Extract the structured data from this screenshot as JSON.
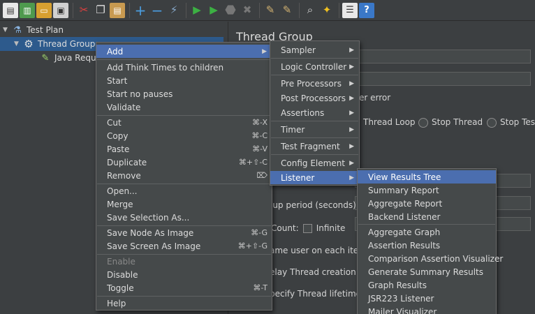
{
  "toolbar": {
    "buttons": [
      {
        "name": "new-icon",
        "glyph": "📄"
      },
      {
        "name": "templates-icon",
        "glyph": "📗"
      },
      {
        "name": "open-icon",
        "glyph": "📂"
      },
      {
        "name": "save-icon",
        "glyph": "💾"
      },
      {
        "name": "cut-icon",
        "glyph": "✂"
      },
      {
        "name": "copy-icon",
        "glyph": "❐"
      },
      {
        "name": "paste-icon",
        "glyph": "📋"
      },
      {
        "name": "expand-icon",
        "glyph": "+"
      },
      {
        "name": "collapse-icon",
        "glyph": "−"
      },
      {
        "name": "toggle-icon",
        "glyph": "⚡"
      },
      {
        "name": "start-icon",
        "glyph": "▶"
      },
      {
        "name": "start-no-pauses-icon",
        "glyph": "▶"
      },
      {
        "name": "stop-icon",
        "glyph": "⬣"
      },
      {
        "name": "shutdown-icon",
        "glyph": "✖"
      },
      {
        "name": "clear-icon",
        "glyph": "🧹"
      },
      {
        "name": "clear-all-icon",
        "glyph": "🧹"
      },
      {
        "name": "search-icon",
        "glyph": "🔭"
      },
      {
        "name": "reset-search-icon",
        "glyph": "🧽"
      },
      {
        "name": "function-helper-icon",
        "glyph": "☰"
      },
      {
        "name": "help-icon",
        "glyph": "?"
      }
    ]
  },
  "tree": {
    "test_plan": "Test Plan",
    "thread_group": "Thread Group",
    "java_request": "Java Requ"
  },
  "right_panel": {
    "title": "Thread Group",
    "error_text": "er error",
    "radio_thread_loop": "Thread Loop",
    "radio_stop_thread": "Stop Thread",
    "radio_stop_test": "Stop Tes",
    "ramp_up": "-up period (seconds):",
    "loop_count": "Count:",
    "infinite": "Infinite",
    "same_user": "ame user on each itera",
    "delay_thread": "elay Thread creation u",
    "specify_lifetime": "pecify Thread lifetime"
  },
  "context_menu": {
    "add": "Add",
    "add_think_times": "Add Think Times to children",
    "start": "Start",
    "start_no_pauses": "Start no pauses",
    "validate": "Validate",
    "cut": "Cut",
    "cut_acc": "⌘-X",
    "copy": "Copy",
    "copy_acc": "⌘-C",
    "paste": "Paste",
    "paste_acc": "⌘-V",
    "duplicate": "Duplicate",
    "duplicate_acc": "⌘+⇧-C",
    "remove": "Remove",
    "remove_acc": "⌦",
    "open": "Open...",
    "merge": "Merge",
    "save_selection_as": "Save Selection As...",
    "save_node_as_image": "Save Node As Image",
    "save_node_acc": "⌘-G",
    "save_screen_as_image": "Save Screen As Image",
    "save_screen_acc": "⌘+⇧-G",
    "enable": "Enable",
    "disable": "Disable",
    "toggle": "Toggle",
    "toggle_acc": "⌘-T",
    "help": "Help"
  },
  "add_menu": {
    "sampler": "Sampler",
    "logic_controller": "Logic Controller",
    "pre_processors": "Pre Processors",
    "post_processors": "Post Processors",
    "assertions": "Assertions",
    "timer": "Timer",
    "test_fragment": "Test Fragment",
    "config_element": "Config Element",
    "listener": "Listener"
  },
  "listener_menu": {
    "view_results_tree": "View Results Tree",
    "summary_report": "Summary Report",
    "aggregate_report": "Aggregate Report",
    "backend_listener": "Backend Listener",
    "aggregate_graph": "Aggregate Graph",
    "assertion_results": "Assertion Results",
    "comparison_assertion_visualizer": "Comparison Assertion Visualizer",
    "generate_summary_results": "Generate Summary Results",
    "graph_results": "Graph Results",
    "jsr223_listener": "JSR223 Listener",
    "mailer_visualizer": "Mailer Visualizer"
  },
  "colors": {
    "background": "#3c3f41",
    "menu_bg": "#45494a",
    "highlight": "#4b6eaf",
    "tree_selection": "#2d5a8c"
  }
}
